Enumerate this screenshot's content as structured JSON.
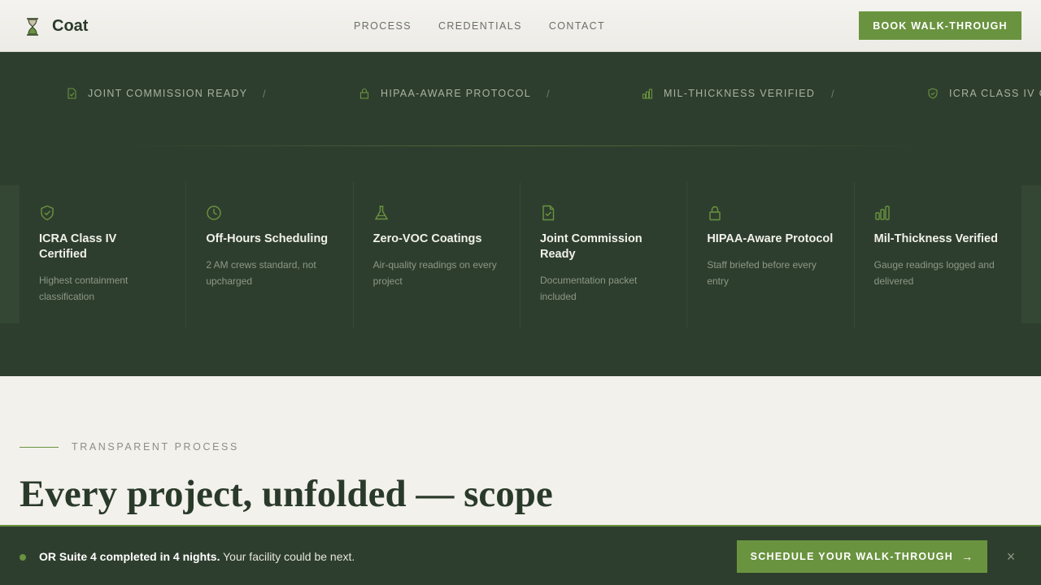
{
  "header": {
    "brand": "Coat",
    "nav": [
      "PROCESS",
      "CREDENTIALS",
      "CONTACT"
    ],
    "cta_label": "BOOK WALK-THROUGH"
  },
  "ticker": {
    "items": [
      {
        "label": "JOINT COMMISSION READY",
        "icon": "document-check-icon"
      },
      {
        "label": "HIPAA-AWARE PROTOCOL",
        "icon": "lock-icon"
      },
      {
        "label": "MIL-THICKNESS VERIFIED",
        "icon": "bar-chart-icon"
      },
      {
        "label": "ICRA CLASS IV C",
        "icon": "shield-check-icon"
      }
    ],
    "separator": "/"
  },
  "features": [
    {
      "title": "ICRA Class IV Certified",
      "desc": "Highest containment classification",
      "icon": "shield-check-icon"
    },
    {
      "title": "Off-Hours Scheduling",
      "desc": "2 AM crews standard, not upcharged",
      "icon": "clock-icon"
    },
    {
      "title": "Zero-VOC Coatings",
      "desc": "Air-quality readings on every project",
      "icon": "flask-icon"
    },
    {
      "title": "Joint Commission Ready",
      "desc": "Documentation packet included",
      "icon": "document-check-icon"
    },
    {
      "title": "HIPAA-Aware Protocol",
      "desc": "Staff briefed before every entry",
      "icon": "lock-icon"
    },
    {
      "title": "Mil-Thickness Verified",
      "desc": "Gauge readings logged and delivered",
      "icon": "bar-chart-icon"
    }
  ],
  "process": {
    "eyebrow": "TRANSPARENT PROCESS",
    "headline": "Every project, unfolded — scope to sign-off."
  },
  "sticky": {
    "bold": "OR Suite 4 completed in 4 nights.",
    "rest": " Your facility could be next.",
    "cta_label": "SCHEDULE YOUR WALK-THROUGH",
    "cta_arrow": "→",
    "close": "×"
  },
  "colors": {
    "accent": "#6a933f",
    "dark_band": "#2e3e2e",
    "background": "#f3f1ec"
  }
}
